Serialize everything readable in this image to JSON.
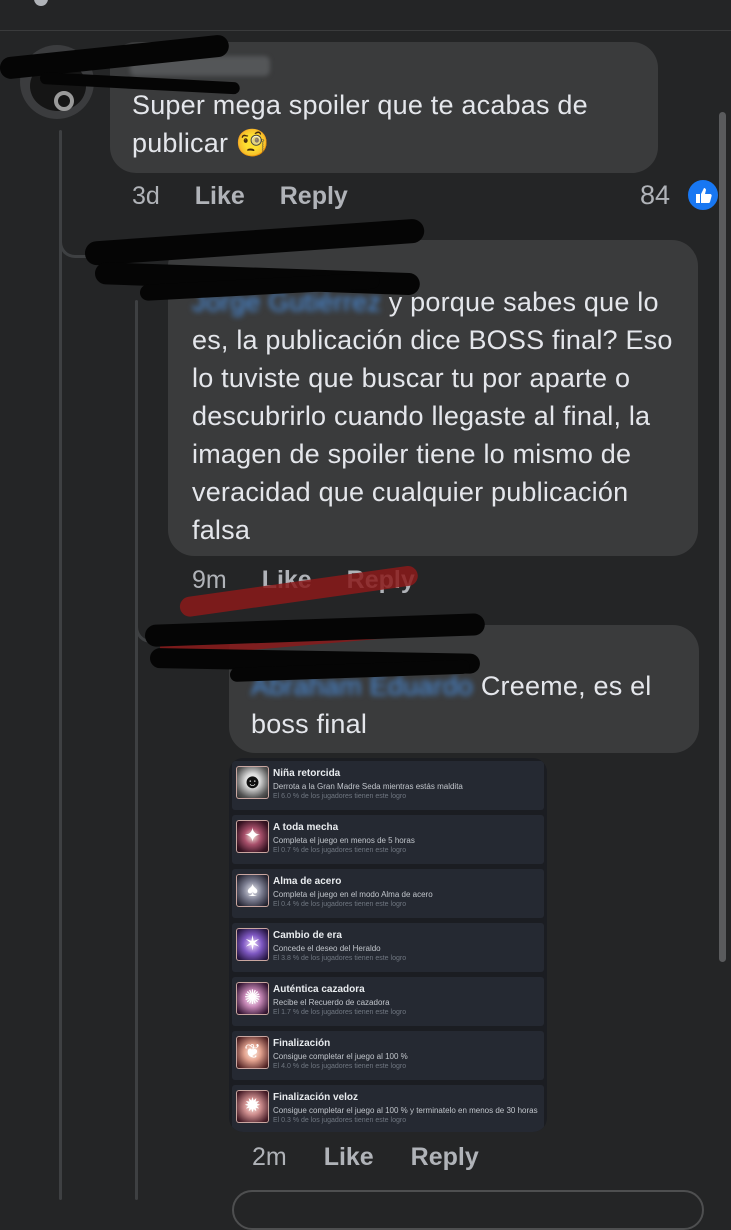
{
  "comment1": {
    "text": "Super mega spoiler que te acabas de publicar 🧐",
    "time": "3d",
    "like_label": "Like",
    "reply_label": "Reply",
    "reaction_count": "84"
  },
  "comment2": {
    "mention": "Jorge Gutiérrez",
    "text": " y porque sabes que lo es, la publicación dice BOSS final? Eso lo tuviste que buscar tu por aparte o descubrirlo cuando llegaste al final, la imagen de spoiler tiene lo mismo de veracidad que cualquier publicación falsa",
    "time": "9m",
    "like_label": "Like",
    "reply_label": "Reply"
  },
  "comment3": {
    "mention": "Abraham Eduardo",
    "text": " Creeme, es el boss final",
    "time": "2m",
    "like_label": "Like",
    "reply_label": "Reply"
  },
  "achievements": [
    {
      "title": "Niña retorcida",
      "desc": "Derrota a la Gran Madre Seda mientras estás maldita",
      "pct": "El 6.0 % de los jugadores tienen este logro",
      "icon": "masked-girl-icon"
    },
    {
      "title": "A toda mecha",
      "desc": "Completa el juego en menos de 5 horas",
      "pct": "El 0.7 % de los jugadores tienen este logro",
      "icon": "needle-icon"
    },
    {
      "title": "Alma de acero",
      "desc": "Completa el juego en el modo Alma de acero",
      "pct": "El 0.4 % de los jugadores tienen este logro",
      "icon": "steel-shell-icon"
    },
    {
      "title": "Cambio de era",
      "desc": "Concede el deseo del Heraldo",
      "pct": "El 3.8 % de los jugadores tienen este logro",
      "icon": "herald-icon"
    },
    {
      "title": "Auténtica cazadora",
      "desc": "Recibe el Recuerdo de cazadora",
      "pct": "El 1.7 % de los jugadores tienen este logro",
      "icon": "hunter-icon"
    },
    {
      "title": "Finalización",
      "desc": "Consigue completar el juego al 100 %",
      "pct": "El 4.0 % de los jugadores tienen este logro",
      "icon": "completion-icon"
    },
    {
      "title": "Finalización veloz",
      "desc": "Consigue completar el juego al 100 % y terminatelo en menos de 30 horas",
      "pct": "El 0.3 % de los jugadores tienen este logro",
      "icon": "speed-completion-icon"
    }
  ],
  "colors": {
    "background": "#242526",
    "bubble": "#3a3b3c",
    "meta_text": "#b0b3b8",
    "like_badge": "#1877f2"
  }
}
